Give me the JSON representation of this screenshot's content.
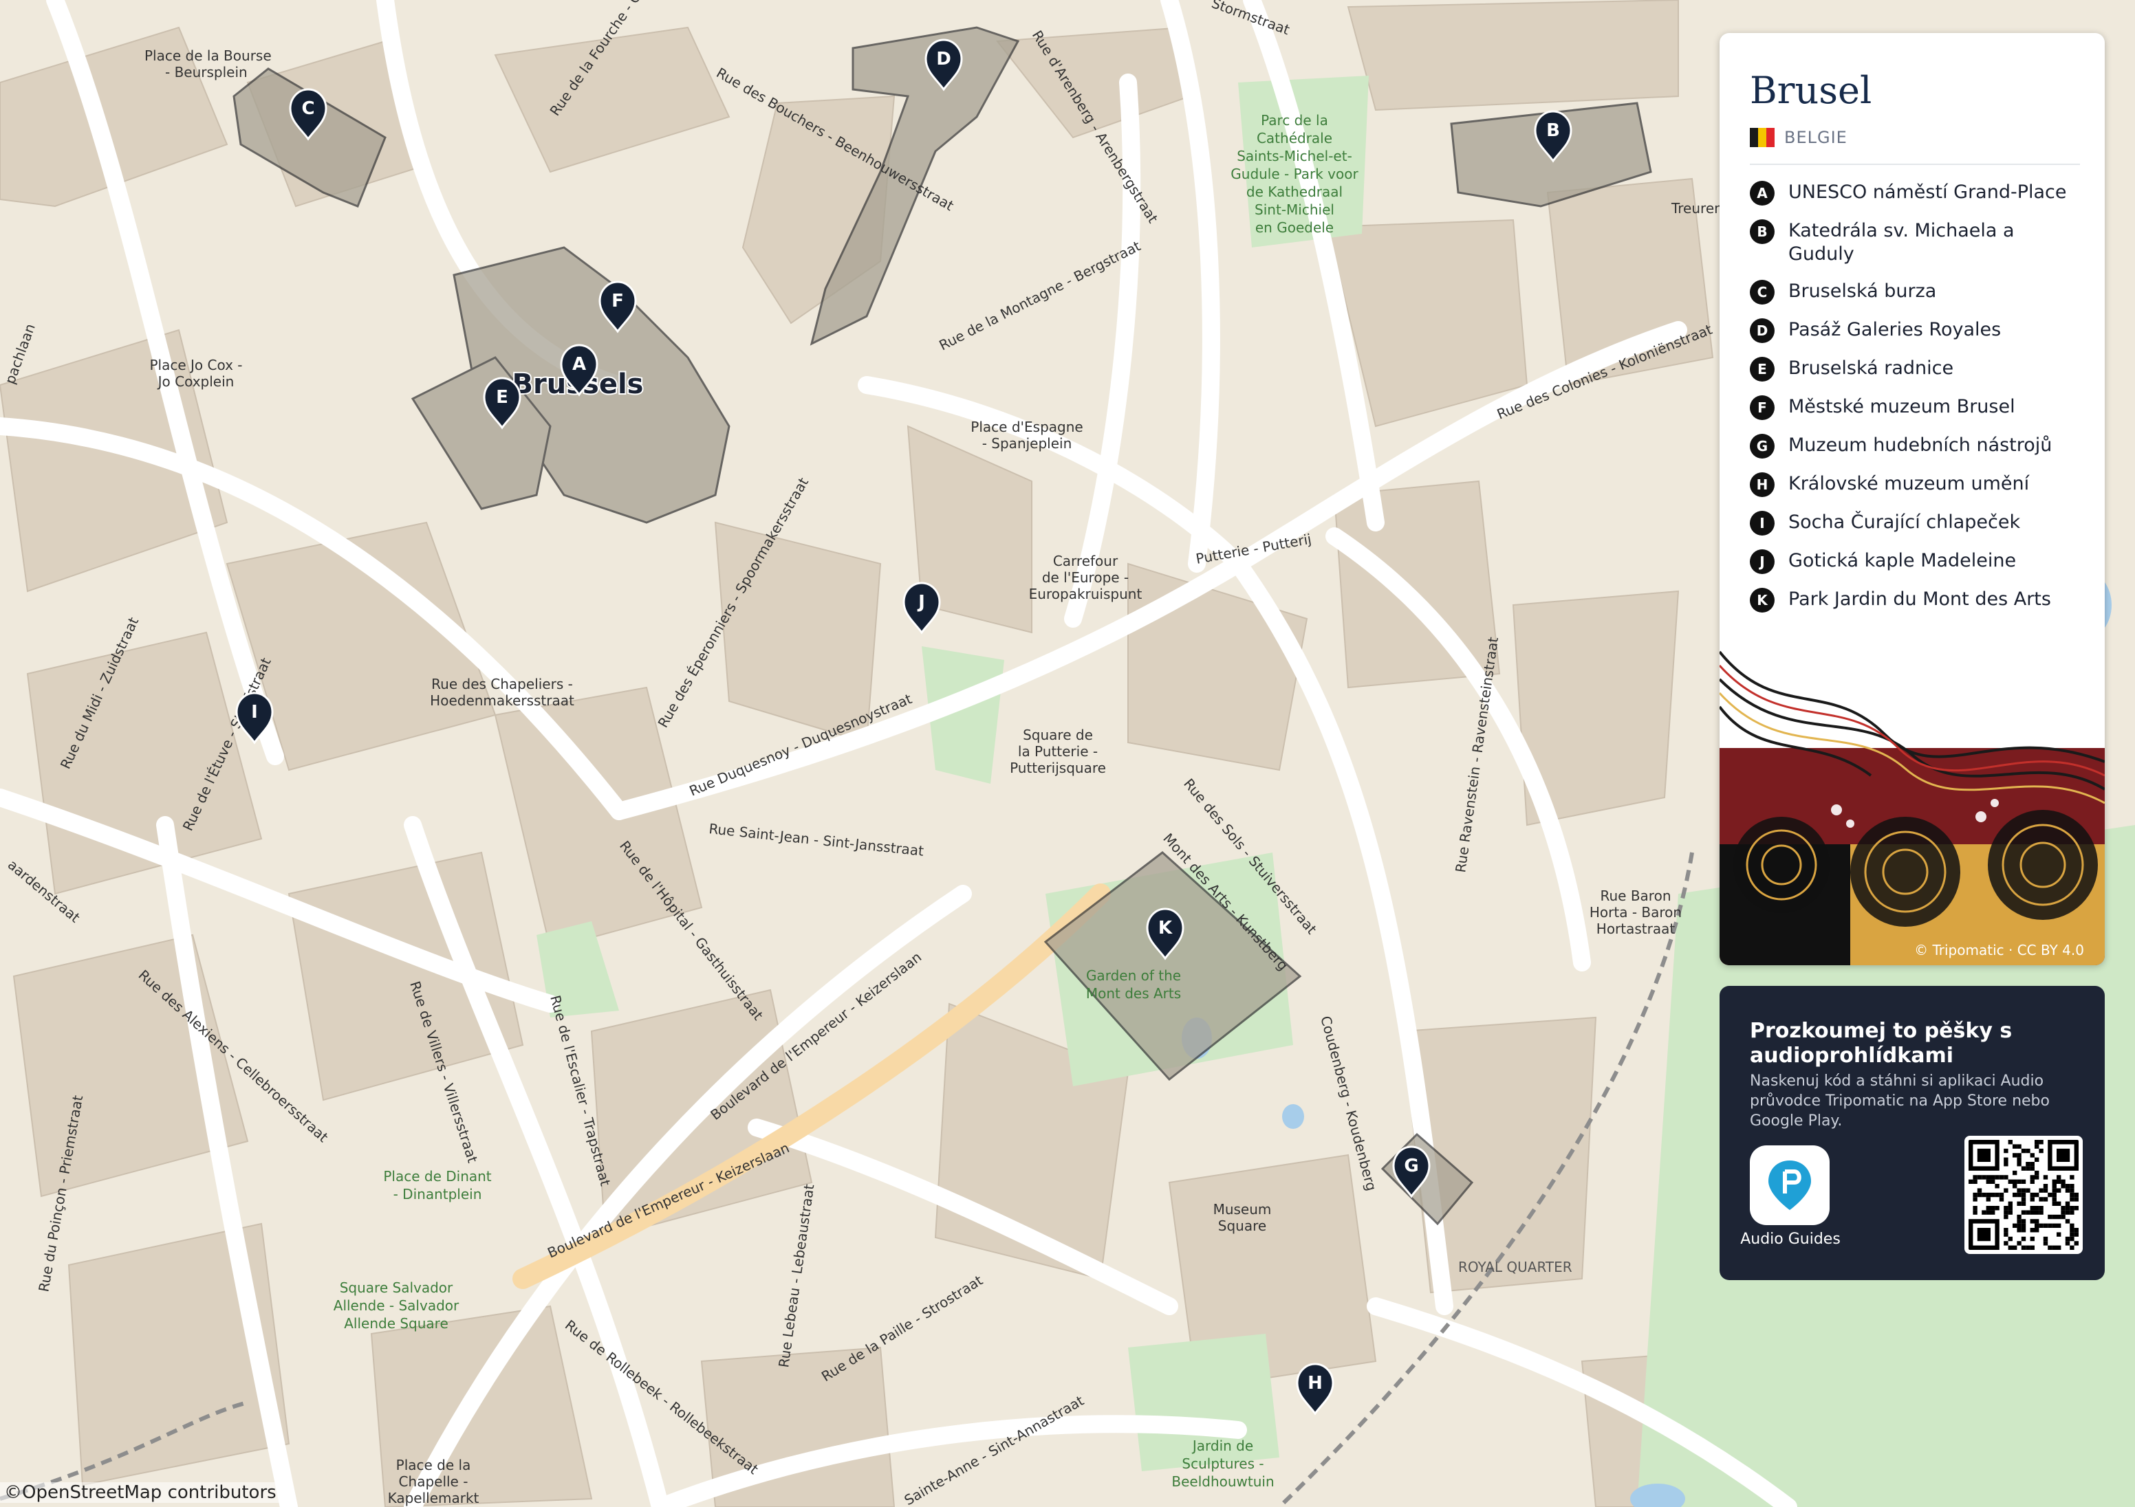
{
  "panel": {
    "title": "Brusel",
    "country": "BELGIE",
    "flag_colors": [
      "#1a1a1a",
      "#f4c400",
      "#e0262b"
    ],
    "credit": "© Tripomatic · CC BY 4.0",
    "items": [
      {
        "letter": "A",
        "label": "UNESCO náměstí Grand-Place"
      },
      {
        "letter": "B",
        "label": "Katedrála sv. Michaela a Guduly"
      },
      {
        "letter": "C",
        "label": "Bruselská burza"
      },
      {
        "letter": "D",
        "label": "Pasáž Galeries Royales"
      },
      {
        "letter": "E",
        "label": "Bruselská radnice"
      },
      {
        "letter": "F",
        "label": "Městské muzeum Brusel"
      },
      {
        "letter": "G",
        "label": "Muzeum hudebních nástrojů"
      },
      {
        "letter": "H",
        "label": "Královské muzeum umění"
      },
      {
        "letter": "I",
        "label": "Socha Čurající chlapeček"
      },
      {
        "letter": "J",
        "label": "Gotická kaple Madeleine"
      },
      {
        "letter": "K",
        "label": "Park Jardin du Mont des Arts"
      }
    ]
  },
  "promo": {
    "title": "Prozkoumej to pěšky s audioprohlídkami",
    "text": "Naskenuj kód a stáhni si aplikaci Audio průvodce Tripomatic na App Store nebo Google Play.",
    "app_label": "Audio Guides"
  },
  "map": {
    "city_label": "Brussels",
    "attribution": "©OpenStreetMap contributors",
    "colors": {
      "background": "#efe9dc",
      "building": "#d9cfbf",
      "park": "#cfe8c6",
      "pin": "#142033",
      "highlight": "#8f897c"
    },
    "pins": [
      {
        "letter": "A"
      },
      {
        "letter": "B"
      },
      {
        "letter": "C"
      },
      {
        "letter": "D"
      },
      {
        "letter": "E"
      },
      {
        "letter": "F"
      },
      {
        "letter": "G"
      },
      {
        "letter": "H"
      },
      {
        "letter": "I"
      },
      {
        "letter": "J"
      },
      {
        "letter": "K"
      }
    ],
    "labels": [
      {
        "key": "bourse1",
        "text": "Place de la Bourse"
      },
      {
        "key": "bourse2",
        "text": "- Beursplein"
      },
      {
        "key": "fourche",
        "text": "Rue de la Fourche - Greepstraat"
      },
      {
        "key": "bouchers",
        "text": "Rue des Bouchers - Beenhouwersstraat"
      },
      {
        "key": "arenberg",
        "text": "Rue d'Arenberg - Arenbergstraat"
      },
      {
        "key": "storm",
        "text": "Stormstraat"
      },
      {
        "key": "parc1",
        "text": "Parc de la"
      },
      {
        "key": "parc2",
        "text": "Cathédrale"
      },
      {
        "key": "parc3",
        "text": "Saints-Michel-et-"
      },
      {
        "key": "parc4",
        "text": "Gudule - Park voor"
      },
      {
        "key": "parc5",
        "text": "de Kathedraal"
      },
      {
        "key": "parc6",
        "text": "Sint-Michiel"
      },
      {
        "key": "parc7",
        "text": "en Goedele"
      },
      {
        "key": "treurenberg",
        "text": "Treuren"
      },
      {
        "key": "montagne",
        "text": "Rue de la Montagne - Bergstraat"
      },
      {
        "key": "colonies",
        "text": "Rue des Colonies - Koloniënstraat"
      },
      {
        "key": "jocox1",
        "text": "Place Jo Cox -"
      },
      {
        "key": "jocox2",
        "text": "Jo Coxplein"
      },
      {
        "key": "espagne1",
        "text": "Place d'Espagne"
      },
      {
        "key": "espagne2",
        "text": "- Spanjeplein"
      },
      {
        "key": "putterie",
        "text": "Putterie - Putterij"
      },
      {
        "key": "europe1",
        "text": "Carrefour"
      },
      {
        "key": "europe2",
        "text": "de l'Europe -"
      },
      {
        "key": "europe3",
        "text": "Europakruispunt"
      },
      {
        "key": "spoormakers",
        "text": "Rue des Éperonniers - Spoormakersstraat"
      },
      {
        "key": "chapeliers1",
        "text": "Rue des Chapeliers -"
      },
      {
        "key": "chapeliers2",
        "text": "Hoedenmakersstraat"
      },
      {
        "key": "duquesnoy",
        "text": "Rue Duquesnoy - Duquesnoystraat"
      },
      {
        "key": "sqput1",
        "text": "Square de"
      },
      {
        "key": "sqput2",
        "text": "la Putterie -"
      },
      {
        "key": "sqput3",
        "text": "Putterijsquare"
      },
      {
        "key": "midi",
        "text": "Rue du Midi - Zuidstraat"
      },
      {
        "key": "etuve",
        "text": "Rue de l'Étuve - Stoofstraat"
      },
      {
        "key": "saintjean",
        "text": "Rue Saint-Jean - Sint-Jansstraat"
      },
      {
        "key": "hopital",
        "text": "Rue de l'Hôpital - Gasthuisstraat"
      },
      {
        "key": "sols",
        "text": "Rue des Sols - Stuiversstraat"
      },
      {
        "key": "montdesarts",
        "text": "Mont des Arts - Kunstberg"
      },
      {
        "key": "ravenstein",
        "text": "Rue Ravenstein - Ravensteinstraat"
      },
      {
        "key": "horta1",
        "text": "Rue Baron"
      },
      {
        "key": "horta2",
        "text": "Horta - Baron"
      },
      {
        "key": "horta3",
        "text": "Hortastraat"
      },
      {
        "key": "garden1",
        "text": "Garden of the"
      },
      {
        "key": "garden2",
        "text": "Mont des Arts"
      },
      {
        "key": "alexiens",
        "text": "Rue des Alexiens - Cellebroersstraat"
      },
      {
        "key": "villers",
        "text": "Rue de Villers - Villersstraat"
      },
      {
        "key": "escalier",
        "text": "Rue de l'Escalier - Trapstraat"
      },
      {
        "key": "empereur1",
        "text": "Boulevard de l'Empereur - Keizerslaan"
      },
      {
        "key": "empereur2",
        "text": "Boulevard de l'Empereur - Keizerslaan"
      },
      {
        "key": "coudenberg",
        "text": "Coudenberg - Koudenberg"
      },
      {
        "key": "dinant1",
        "text": "Place de Dinant"
      },
      {
        "key": "dinant2",
        "text": "- Dinantplein"
      },
      {
        "key": "museum1",
        "text": "Museum"
      },
      {
        "key": "museum2",
        "text": "Square"
      },
      {
        "key": "royal",
        "text": "ROYAL QUARTER"
      },
      {
        "key": "poincon",
        "text": "Rue du Poinçon - Priemstraat"
      },
      {
        "key": "allende1",
        "text": "Square Salvador"
      },
      {
        "key": "allende2",
        "text": "Allende - Salvador"
      },
      {
        "key": "allende3",
        "text": "Allende Square"
      },
      {
        "key": "lebeau",
        "text": "Rue Lebeau - Lebeaustraat"
      },
      {
        "key": "paille",
        "text": "Rue de la Paille - Strostraat"
      },
      {
        "key": "rollebeek",
        "text": "Rue de Rollebeek - Rollebeekstraat"
      },
      {
        "key": "sainteanne",
        "text": "Sainte-Anne - Sint-Annastraat"
      },
      {
        "key": "jardin1",
        "text": "Jardin de"
      },
      {
        "key": "jardin2",
        "text": "Sculptures -"
      },
      {
        "key": "jardin3",
        "text": "Beeldhouwtuin"
      },
      {
        "key": "chapelle1",
        "text": "Place de la"
      },
      {
        "key": "chapelle2",
        "text": "Chapelle -"
      },
      {
        "key": "chapelle3",
        "text": "Kapellemarkt"
      },
      {
        "key": "aardenstraat",
        "text": "aardenstraat"
      },
      {
        "key": "pachilaan",
        "text": "pachlaan"
      }
    ]
  }
}
